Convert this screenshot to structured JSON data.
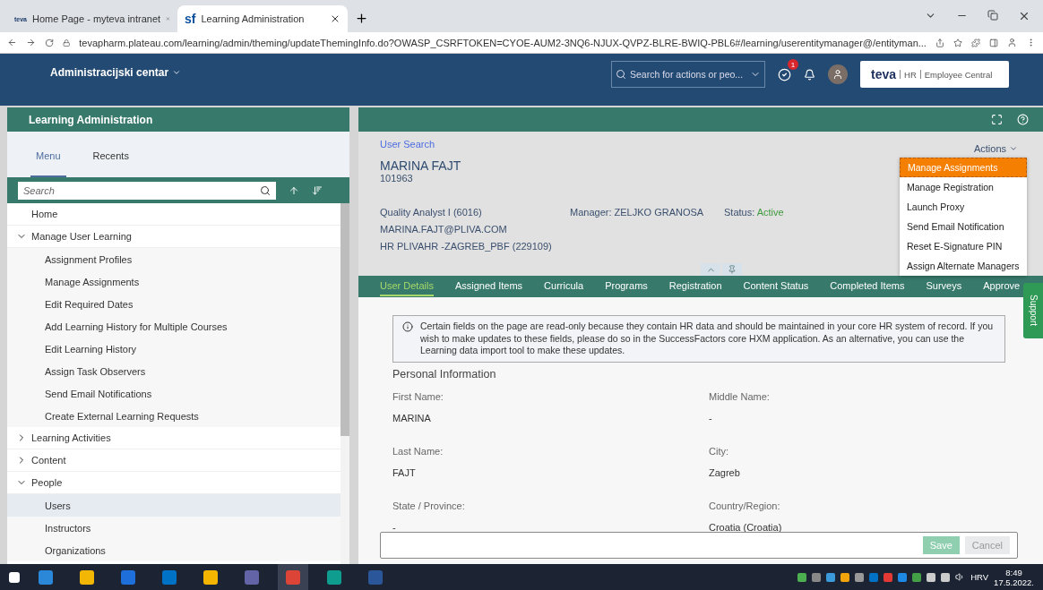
{
  "browser": {
    "tabs": [
      {
        "favicon": "teva",
        "label": "Home Page - myteva intranet",
        "selected": false
      },
      {
        "favicon": "sf",
        "label": "Learning Administration",
        "selected": true
      }
    ],
    "url": "tevapharm.plateau.com/learning/admin/theming/updateThemingInfo.do?OWASP_CSRFTOKEN=CYOE-AUM2-3NQ6-NJUX-QVPZ-BLRE-BWIQ-PBL6#/learning/userentitymanager@/entityman..."
  },
  "header": {
    "title": "Administracijski centar",
    "search_placeholder": "Search for actions or peo...",
    "notification_count": "1",
    "brand_logo": "teva",
    "brand_area": "HR",
    "brand_product": "Employee Central"
  },
  "left_panel": {
    "title": "Learning Administration",
    "tabs": [
      {
        "label": "Menu",
        "selected": true
      },
      {
        "label": "Recents",
        "selected": false
      }
    ],
    "search_placeholder": "Search",
    "menu": [
      {
        "label": "Home",
        "selected": false
      },
      {
        "label": "Manage User Learning",
        "expanded": true,
        "selected": false,
        "children": [
          {
            "label": "Assignment Profiles",
            "selected": false
          },
          {
            "label": "Manage Assignments",
            "selected": false
          },
          {
            "label": "Edit Required Dates",
            "selected": false
          },
          {
            "label": "Add Learning History for Multiple Courses",
            "selected": false
          },
          {
            "label": "Edit Learning History",
            "selected": false
          },
          {
            "label": "Assign Task Observers",
            "selected": false
          },
          {
            "label": "Send Email Notifications",
            "selected": false
          },
          {
            "label": "Create External Learning Requests",
            "selected": false
          }
        ]
      },
      {
        "label": "Learning Activities",
        "expanded": false,
        "selected": false
      },
      {
        "label": "Content",
        "expanded": false,
        "selected": false
      },
      {
        "label": "People",
        "expanded": true,
        "selected": false,
        "children": [
          {
            "label": "Users",
            "selected": true
          },
          {
            "label": "Instructors",
            "selected": false
          },
          {
            "label": "Organizations",
            "selected": false
          }
        ]
      }
    ]
  },
  "user": {
    "breadcrumb": "User Search",
    "name": "MARINA FAJT",
    "id": "101963",
    "job": "Quality Analyst I (6016)",
    "email": "MARINA.FAJT@PLIVA.COM",
    "org": "HR PLIVAHR -ZAGREB_PBF (229109)",
    "manager": "Manager: ZELJKO GRANOSA",
    "status_label": "Status:",
    "status_value": "Active"
  },
  "actions": {
    "label": "Actions",
    "items": [
      {
        "label": "Manage Assignments",
        "selected": true
      },
      {
        "label": "Manage Registration",
        "selected": false
      },
      {
        "label": "Launch Proxy",
        "selected": false
      },
      {
        "label": "Send Email Notification",
        "selected": false
      },
      {
        "label": "Reset E-Signature PIN",
        "selected": false
      },
      {
        "label": "Assign Alternate Managers",
        "selected": false
      }
    ]
  },
  "detail_tabs": [
    {
      "label": "User Details",
      "selected": true
    },
    {
      "label": "Assigned Items",
      "selected": false
    },
    {
      "label": "Curricula",
      "selected": false
    },
    {
      "label": "Programs",
      "selected": false
    },
    {
      "label": "Registration",
      "selected": false
    },
    {
      "label": "Content Status",
      "selected": false
    },
    {
      "label": "Completed Items",
      "selected": false
    },
    {
      "label": "Surveys",
      "selected": false
    },
    {
      "label": "Approve",
      "selected": false
    }
  ],
  "notice": "Certain fields on the page are read-only because they contain HR data and should be maintained in your core HR system of record. If you wish to make updates to these fields, please do so in the SuccessFactors core HXM application. As an alternative, you can use the Learning data import tool to make these updates.",
  "section_title": "Personal Information",
  "fields": [
    {
      "label": "First Name:",
      "value": "MARINA"
    },
    {
      "label": "Middle Name:",
      "value": "-"
    },
    {
      "label": "Last Name:",
      "value": "FAJT"
    },
    {
      "label": "City:",
      "value": "Zagreb"
    },
    {
      "label": "State / Province:",
      "value": "-"
    },
    {
      "label": "Country/Region:",
      "value": "Croatia (Croatia)"
    }
  ],
  "footer_buttons": [
    {
      "label": "Save",
      "kind": "primary",
      "disabled": true
    },
    {
      "label": "Cancel",
      "kind": "secondary",
      "disabled": true
    }
  ],
  "support_label": "Support",
  "taskbar": {
    "language": "HRV",
    "time": "8:49",
    "date": "17.5.2022."
  }
}
